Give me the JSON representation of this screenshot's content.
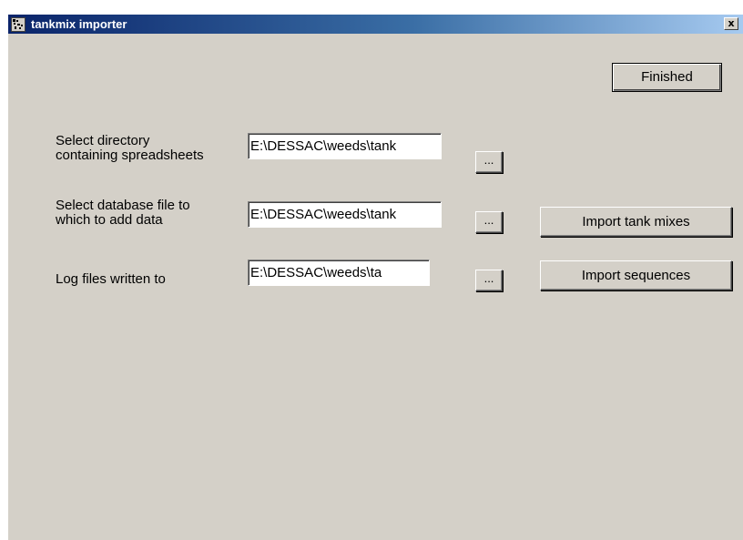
{
  "window": {
    "title": "tankmix importer",
    "icon": "tankmix-app-icon",
    "close_symbol": "x"
  },
  "buttons": {
    "finished": "Finished",
    "import_tank_mixes": "Import tank mixes",
    "import_sequences": "Import sequences",
    "browse": "..."
  },
  "fields": {
    "spreadsheet_dir": {
      "label_line1": "Select directory",
      "label_line2": "containing spreadsheets",
      "value": "E:\\DESSAC\\weeds\\tank"
    },
    "database_file": {
      "label_line1": "Select database file to",
      "label_line2": "which to add data",
      "value": "E:\\DESSAC\\weeds\\tank"
    },
    "log_files": {
      "label": "Log files written to",
      "value": "E:\\DESSAC\\weeds\\ta"
    }
  },
  "colors": {
    "dialog_face": "#d4d0c8",
    "titlebar_start": "#0a246a",
    "titlebar_end": "#a6caf0"
  }
}
